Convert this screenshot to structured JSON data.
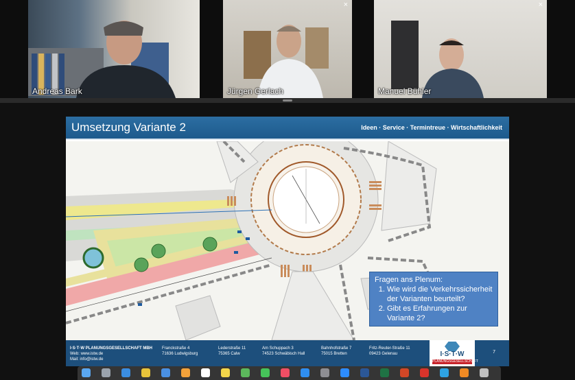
{
  "participants": [
    {
      "name": "Andreas Bark"
    },
    {
      "name": "Jürgen Gerlach",
      "close": "×"
    },
    {
      "name": "Manuel Bühler",
      "close": "×"
    }
  ],
  "slide": {
    "title": "Umsetzung Variante 2",
    "tagline": "Ideen · Service · Termintreue · Wirtschaftlichkeit",
    "callout": {
      "heading": "Fragen ans Plenum:",
      "items": [
        "Wie wird die Verkehrssicherheit der Varianten beurteilt?",
        "Gibt es Erfahrungen zur Variante 2?"
      ]
    },
    "footer": {
      "company": "I·S·T·W PLANUNGSGESELLSCHAFT MBH",
      "web": "Web: www.istw.de",
      "mail": "Mail: info@istw.de",
      "addresses": [
        {
          "street": "Franckstraße 4",
          "city": "71636 Ludwigsburg"
        },
        {
          "street": "Lederstraße 11",
          "city": "75365 Calw"
        },
        {
          "street": "Am Schuppach 3",
          "city": "74523 Schwäbisch Hall"
        },
        {
          "street": "Bahnhofstraße 7",
          "city": "75015 Bretten"
        },
        {
          "street": "Fritz-Reuter-Straße 11",
          "city": "09423 Gelenau"
        }
      ],
      "logo_text": "I·S·T·W",
      "logo_sub": "PLANUNGSGESELLSCHAFT",
      "page": "7"
    }
  },
  "dock_icons": [
    "finder-icon",
    "launchpad-icon",
    "safari-icon",
    "chrome-icon",
    "mail-icon",
    "photos-icon",
    "calendar-icon",
    "notes-icon",
    "maps-icon",
    "messages-icon",
    "music-icon",
    "appstore-icon",
    "settings-icon",
    "zoom-icon",
    "word-icon",
    "excel-icon",
    "powerpoint-icon",
    "acrobat-icon",
    "photoshop-icon",
    "vlc-icon",
    "trash-icon"
  ]
}
